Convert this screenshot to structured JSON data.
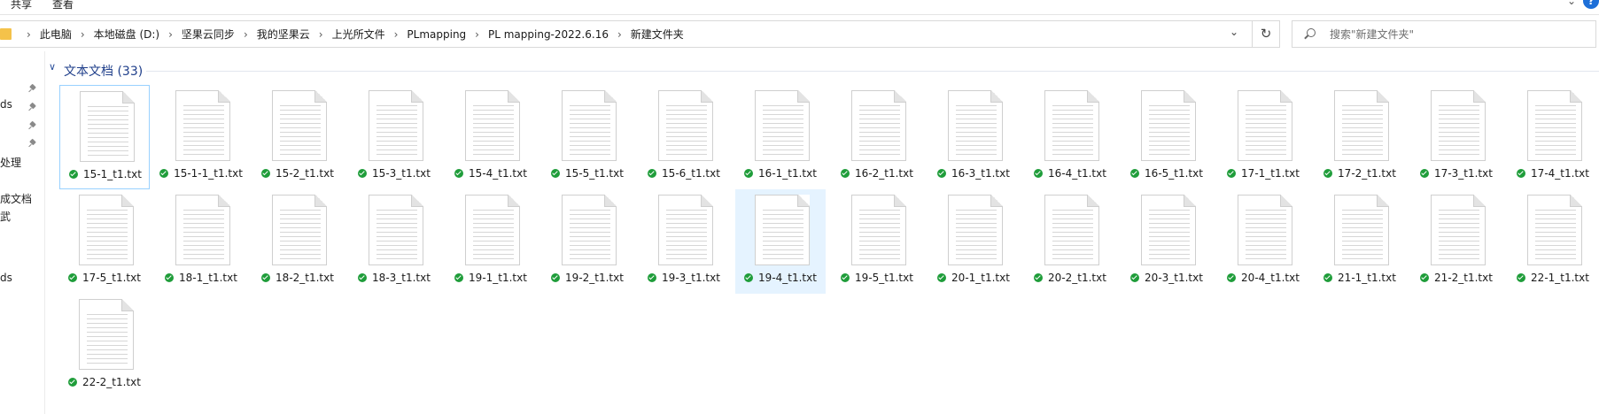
{
  "ribbon": {
    "tabs": [
      "共享",
      "查看"
    ]
  },
  "address": {
    "crumbs": [
      "此电脑",
      "本地磁盘 (D:)",
      "坚果云同步",
      "我的坚果云",
      "上光所文件",
      "PLmapping",
      "PL mapping-2022.6.16",
      "新建文件夹"
    ]
  },
  "search": {
    "placeholder": "搜索\"新建文件夹\""
  },
  "nav": {
    "items": [
      "ds",
      "处理",
      "成文档",
      "武",
      "ds"
    ]
  },
  "group": {
    "title": "文本文档 (33)"
  },
  "files": [
    "15-1_t1.txt",
    "15-1-1_t1.txt",
    "15-2_t1.txt",
    "15-3_t1.txt",
    "15-4_t1.txt",
    "15-5_t1.txt",
    "15-6_t1.txt",
    "16-1_t1.txt",
    "16-2_t1.txt",
    "16-3_t1.txt",
    "16-4_t1.txt",
    "16-5_t1.txt",
    "17-1_t1.txt",
    "17-2_t1.txt",
    "17-3_t1.txt",
    "17-4_t1.txt",
    "17-5_t1.txt",
    "18-1_t1.txt",
    "18-2_t1.txt",
    "18-3_t1.txt",
    "19-1_t1.txt",
    "19-2_t1.txt",
    "19-3_t1.txt",
    "19-4_t1.txt",
    "19-5_t1.txt",
    "20-1_t1.txt",
    "20-2_t1.txt",
    "20-3_t1.txt",
    "20-4_t1.txt",
    "21-1_t1.txt",
    "21-2_t1.txt",
    "22-1_t1.txt",
    "22-2_t1.txt"
  ],
  "focused_file": "15-1_t1.txt",
  "selected_file": "19-4_t1.txt",
  "icons": {
    "sync_status": "sync-ok-icon",
    "file_type": "text-document-icon",
    "pin": "pin-icon"
  },
  "colors": {
    "sync_ok": "#1f9d3a",
    "selection": "#cce8ff",
    "group_title": "#1e3e8a"
  }
}
